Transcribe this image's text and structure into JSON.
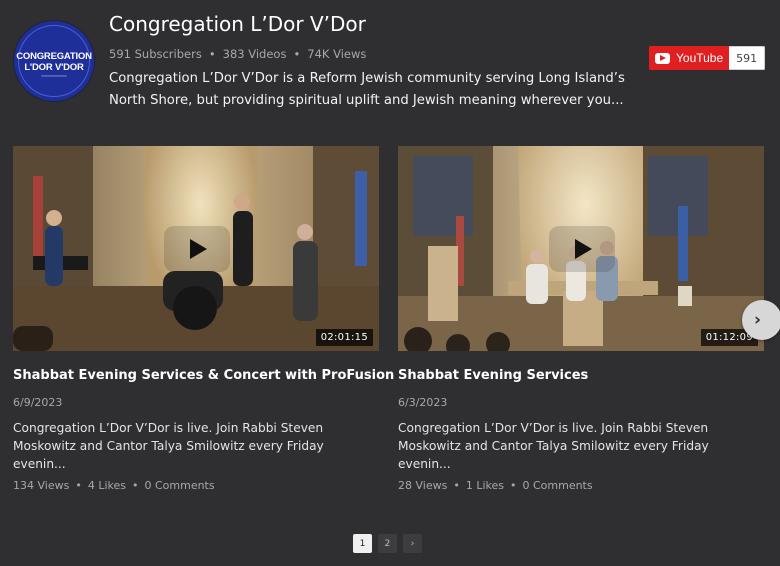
{
  "channel": {
    "title": "Congregation L’Dor V’Dor",
    "avatar_line1": "CONGREGATION",
    "avatar_line2": "L'DOR V'DOR",
    "subscribers": "591 Subscribers",
    "videos": "383 Videos",
    "views": "74K Views",
    "separator": "•",
    "description": "Congregation L’Dor V’Dor is a Reform Jewish community serving Long Island’s North Shore, but providing spiritual uplift and Jewish meaning wherever you..."
  },
  "subscribe": {
    "label": "YouTube",
    "count": "591"
  },
  "videos": [
    {
      "title": "Shabbat Evening Services & Concert with ProFusion",
      "date": "6/9/2023",
      "duration": "02:01:15",
      "description": "Congregation L’Dor V’Dor is live. Join Rabbi Steven Moskowitz and Cantor Talya Smilowitz every Friday evenin...",
      "views": "134 Views",
      "likes": "4 Likes",
      "comments": "0 Comments"
    },
    {
      "title": "Shabbat Evening Services",
      "date": "6/3/2023",
      "duration": "01:12:09",
      "description": "Congregation L’Dor V’Dor is live. Join Rabbi Steven Moskowitz and Cantor Talya Smilowitz every Friday evenin...",
      "views": "28 Views",
      "likes": "1 Likes",
      "comments": "0 Comments"
    }
  ],
  "carousel": {
    "next_icon": "chevron-right-icon",
    "next_symbol": "›"
  },
  "pagination": {
    "pages": [
      "1",
      "2"
    ],
    "current": "1",
    "next_symbol": "›"
  },
  "colors": {
    "background": "#2f2f31",
    "youtube_red": "#e02020",
    "muted_text": "#a8a8aa"
  }
}
